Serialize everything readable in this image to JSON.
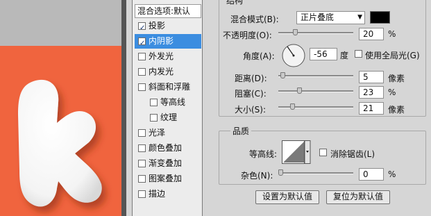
{
  "styles_list": {
    "header": "混合选项:默认",
    "items": [
      {
        "label": "投影",
        "checked": true,
        "selected": false,
        "sub": false
      },
      {
        "label": "内阴影",
        "checked": true,
        "selected": true,
        "sub": false
      },
      {
        "label": "外发光",
        "checked": false,
        "selected": false,
        "sub": false
      },
      {
        "label": "内发光",
        "checked": false,
        "selected": false,
        "sub": false
      },
      {
        "label": "斜面和浮雕",
        "checked": false,
        "selected": false,
        "sub": false
      },
      {
        "label": "等高线",
        "checked": false,
        "selected": false,
        "sub": true
      },
      {
        "label": "纹理",
        "checked": false,
        "selected": false,
        "sub": true
      },
      {
        "label": "光泽",
        "checked": false,
        "selected": false,
        "sub": false
      },
      {
        "label": "颜色叠加",
        "checked": false,
        "selected": false,
        "sub": false
      },
      {
        "label": "渐变叠加",
        "checked": false,
        "selected": false,
        "sub": false
      },
      {
        "label": "图案叠加",
        "checked": false,
        "selected": false,
        "sub": false
      },
      {
        "label": "描边",
        "checked": false,
        "selected": false,
        "sub": false
      }
    ],
    "check_mark": "✓"
  },
  "structure": {
    "legend": "结构",
    "blend_mode_label": "混合模式(B):",
    "blend_mode_value": "正片叠底",
    "blend_color": "#000000",
    "opacity_label": "不透明度(O):",
    "opacity_value": "20",
    "opacity_unit": "%",
    "angle_label": "角度(A):",
    "angle_value": "-56",
    "angle_unit": "度",
    "global_light_label": "使用全局光(G)",
    "distance_label": "距离(D):",
    "distance_value": "5",
    "distance_unit": "像素",
    "choke_label": "阻塞(C):",
    "choke_value": "23",
    "choke_unit": "%",
    "size_label": "大小(S):",
    "size_value": "21",
    "size_unit": "像素"
  },
  "quality": {
    "legend": "品质",
    "contour_label": "等高线:",
    "antialias_label": "消除锯齿(L)",
    "noise_label": "杂色(N):",
    "noise_value": "0",
    "noise_unit": "%"
  },
  "buttons": {
    "make_default": "设置为默认值",
    "reset_default": "复位为默认值"
  },
  "canvas": {
    "bg_color": "#f0643e"
  }
}
